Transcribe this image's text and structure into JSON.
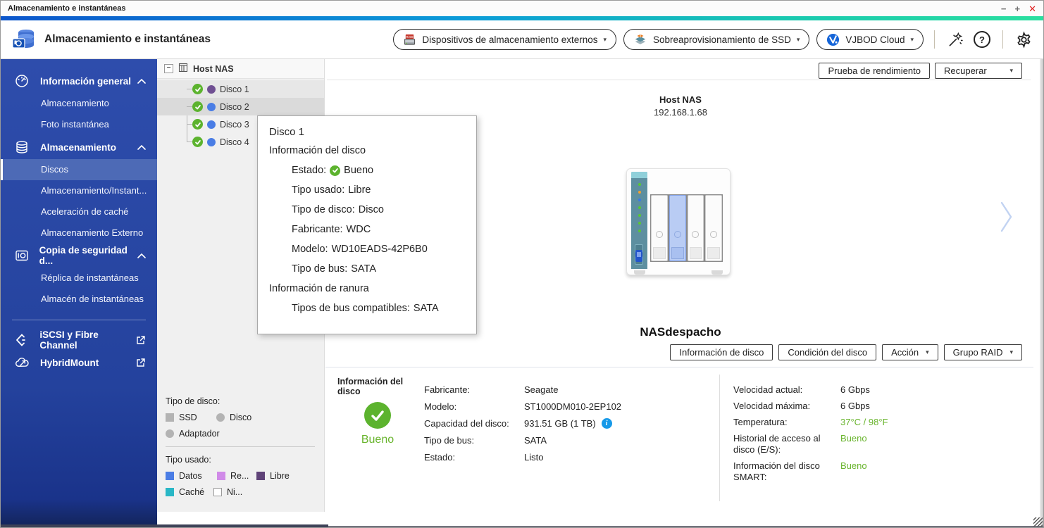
{
  "window": {
    "title": "Almacenamiento e instantáneas",
    "controls": {
      "minimize": "−",
      "maximize": "+",
      "close": "✕"
    }
  },
  "header": {
    "title": "Almacenamiento e instantáneas",
    "buttons": [
      {
        "label": "Dispositivos de almacenamiento externos",
        "icon": "external-storage-raid-icon",
        "dropdown": true
      },
      {
        "label": "Sobreaprovisionamiento de SSD",
        "icon": "ssd-overprovisioning-icon",
        "dropdown": true
      },
      {
        "label": "VJBOD Cloud",
        "icon": "vjbod-cloud-icon",
        "dropdown": true
      }
    ],
    "tool_icons": [
      "magic-wand-icon",
      "help-icon",
      "settings-icon"
    ]
  },
  "sidebar": {
    "sections": [
      {
        "label": "Información general",
        "icon": "gauge-icon",
        "expanded": true,
        "items": [
          {
            "label": "Almacenamiento"
          },
          {
            "label": "Foto instantánea"
          }
        ]
      },
      {
        "label": "Almacenamiento",
        "icon": "storage-disks-icon",
        "expanded": true,
        "items": [
          {
            "label": "Discos",
            "selected": true
          },
          {
            "label": "Almacenamiento/Instant..."
          },
          {
            "label": "Aceleración de caché"
          },
          {
            "label": "Almacenamiento Externo"
          }
        ]
      },
      {
        "label": "Copia de seguridad d...",
        "icon": "snapshot-camera-icon",
        "expanded": true,
        "items": [
          {
            "label": "Réplica de instantáneas"
          },
          {
            "label": "Almacén de instantáneas"
          }
        ]
      }
    ],
    "links": [
      {
        "label": "iSCSI y Fibre Channel",
        "icon": "iscsi-icon",
        "external": true
      },
      {
        "label": "HybridMount",
        "icon": "hybridmount-cloud-icon",
        "external": true
      }
    ]
  },
  "tree": {
    "root_label": "Host NAS",
    "disks": [
      {
        "label": "Disco 1",
        "status": "good",
        "dot_color": "#6f4f92",
        "state": "hover"
      },
      {
        "label": "Disco 2",
        "status": "good",
        "dot_color": "#4a7de5",
        "state": "selected"
      },
      {
        "label": "Disco 3",
        "status": "good",
        "dot_color": "#4a7de5",
        "state": ""
      },
      {
        "label": "Disco 4",
        "status": "good",
        "dot_color": "#4a7de5",
        "state": ""
      }
    ],
    "legend": {
      "disk_type_title": "Tipo de disco:",
      "disk_types": [
        {
          "label": "SSD",
          "shape": "square",
          "color": "#b3b3b3"
        },
        {
          "label": "Disco",
          "shape": "circle",
          "color": "#b3b3b3"
        },
        {
          "label": "Adaptador",
          "shape": "circle",
          "color": "#b3b3b3"
        }
      ],
      "used_type_title": "Tipo usado:",
      "used_types": [
        {
          "label": "Datos",
          "color": "#4a7de5"
        },
        {
          "label": "Re...",
          "color": "#d08ae8"
        },
        {
          "label": "Libre",
          "color": "#5f4378"
        },
        {
          "label": "Caché",
          "color": "#29b7c6"
        },
        {
          "label": "Ni...",
          "color": "#ffffff",
          "outline": true
        }
      ]
    }
  },
  "tooltip": {
    "title": "Disco 1",
    "sections": [
      {
        "header": "Información del disco",
        "rows": [
          {
            "label": "Estado:",
            "value": "Bueno",
            "icon": "status-good-icon"
          },
          {
            "label": "Tipo usado:",
            "value": "Libre"
          },
          {
            "label": "Tipo de disco:",
            "value": "Disco"
          },
          {
            "label": "Fabricante:",
            "value": "WDC"
          },
          {
            "label": "Modelo:",
            "value": "WD10EADS-42P6B0"
          },
          {
            "label": "Tipo de bus:",
            "value": "SATA"
          }
        ]
      },
      {
        "header": "Información de ranura",
        "rows": [
          {
            "label": "Tipos de bus compatibles:",
            "value": "SATA"
          }
        ]
      }
    ]
  },
  "main": {
    "toolbar": [
      {
        "label": "Prueba de rendimiento",
        "dropdown": false
      },
      {
        "label": "Recuperar",
        "dropdown": true
      }
    ],
    "host": {
      "name": "Host NAS",
      "ip": "192.168.1.68"
    },
    "nas_name": "NASdespacho",
    "nas_buttons": [
      {
        "label": "Información de disco",
        "dropdown": false
      },
      {
        "label": "Condición del disco",
        "dropdown": false
      },
      {
        "label": "Acción",
        "dropdown": true
      },
      {
        "label": "Grupo RAID",
        "dropdown": true
      }
    ],
    "nas_device": {
      "bays": 4,
      "selected_bay": 2
    }
  },
  "details": {
    "panel_title": "Información del disco",
    "health_label": "Bueno",
    "left_rows": [
      {
        "label": "Fabricante:",
        "value": "Seagate"
      },
      {
        "label": "Modelo:",
        "value": "ST1000DM010-2EP102"
      },
      {
        "label": "Capacidad del disco:",
        "value": "931.51 GB (1 TB)",
        "info": true
      },
      {
        "label": "Tipo de bus:",
        "value": "SATA"
      },
      {
        "label": "Estado:",
        "value": "Listo"
      }
    ],
    "right_rows": [
      {
        "label": "Velocidad actual:",
        "value": "6 Gbps"
      },
      {
        "label": "Velocidad máxima:",
        "value": "6 Gbps"
      },
      {
        "label": "Temperatura:",
        "value": "37°C / 98°F",
        "green": true
      },
      {
        "label": "Historial de acceso al disco (E/S):",
        "value": "Bueno",
        "green": true
      },
      {
        "label": "Información del disco SMART:",
        "value": "Bueno",
        "green": true
      }
    ]
  },
  "colors": {
    "accent_blue": "#2e4dac",
    "selected_item": "#4d6ab6",
    "good_green": "#5cb32e",
    "green_text": "#68b42c",
    "info_blue": "#1699e8",
    "bay_highlight": "#b9ccf4"
  }
}
